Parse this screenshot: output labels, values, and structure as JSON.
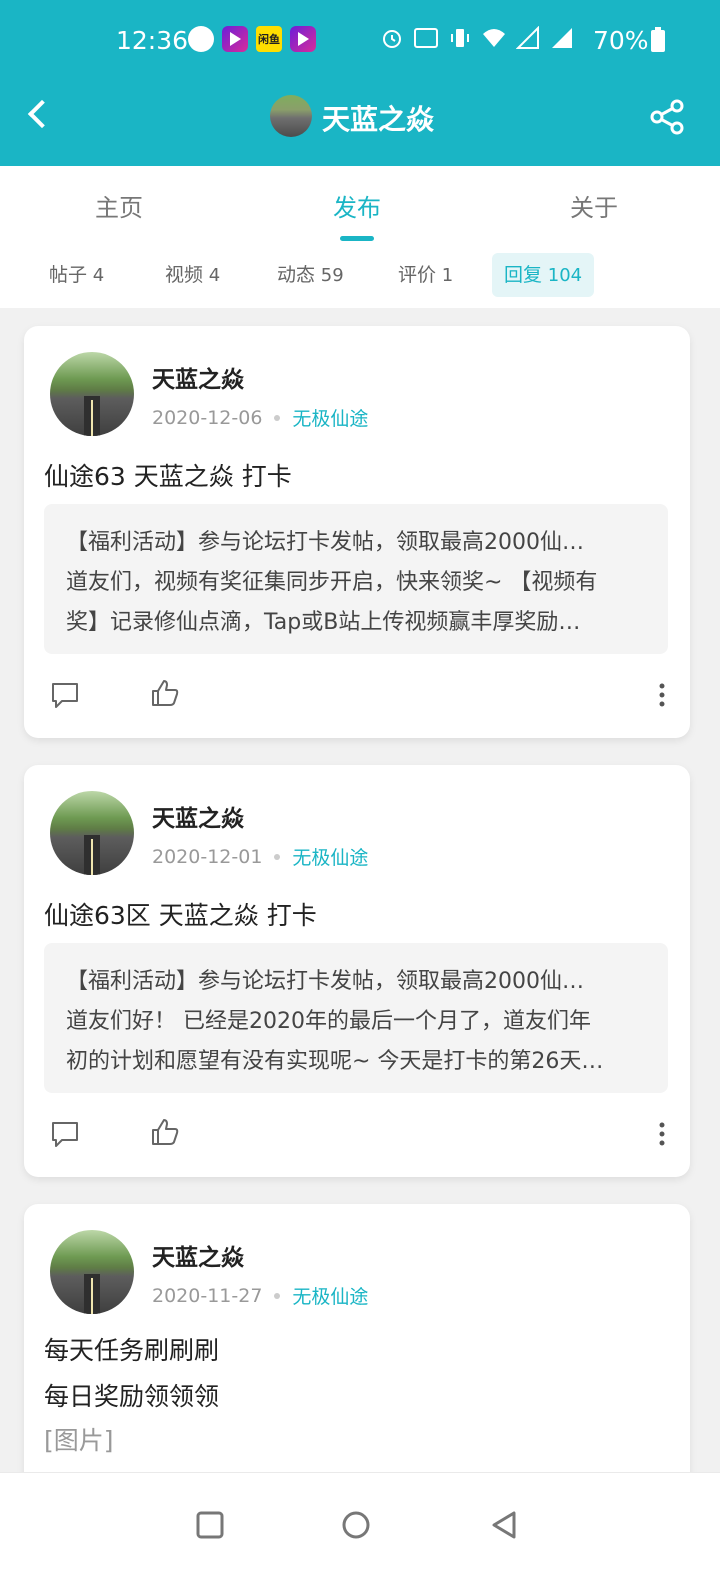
{
  "status_bar": {
    "time": "12:36",
    "yellow_app_text": "闲鱼",
    "battery_percent": "70%"
  },
  "header": {
    "title": "天蓝之焱"
  },
  "tabs": [
    {
      "label": "主页"
    },
    {
      "label": "发布"
    },
    {
      "label": "关于"
    }
  ],
  "subtabs": [
    {
      "label": "帖子",
      "count": "4"
    },
    {
      "label": "视频",
      "count": "4"
    },
    {
      "label": "动态",
      "count": "59"
    },
    {
      "label": "评价",
      "count": "1"
    },
    {
      "label": "回复",
      "count": "104"
    }
  ],
  "posts": [
    {
      "author": "天蓝之焱",
      "date": "2020-12-06",
      "forum": "无极仙途",
      "title_lines": [
        "仙途63 天蓝之焱 打卡"
      ],
      "quote_lines": [
        "【福利活动】参与论坛打卡发帖，领取最高2000仙…",
        "道友们，视频有奖征集同步开启，快来领奖~ 【视频有",
        "奖】记录修仙点滴，Tap或B站上传视频赢丰厚奖励…"
      ]
    },
    {
      "author": "天蓝之焱",
      "date": "2020-12-01",
      "forum": "无极仙途",
      "title_lines": [
        "仙途63区 天蓝之焱 打卡"
      ],
      "quote_lines": [
        "【福利活动】参与论坛打卡发帖，领取最高2000仙…",
        "道友们好！ 已经是2020年的最后一个月了，道友们年",
        "初的计划和愿望有没有实现呢~ 今天是打卡的第26天…"
      ]
    },
    {
      "author": "天蓝之焱",
      "date": "2020-11-27",
      "forum": "无极仙途",
      "title_lines": [
        "每天任务刷刷刷",
        "每日奖励领领领"
      ],
      "image_placeholder": "[图片]"
    }
  ],
  "colors": {
    "accent": "#1ab5c5",
    "background": "#f1f1f1"
  }
}
